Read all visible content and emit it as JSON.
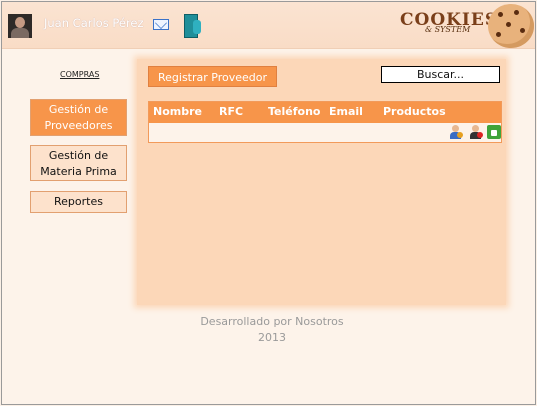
{
  "header": {
    "user_name": "Juan Carlos Pérez",
    "logo_text": "COOKIES",
    "logo_subtext": "& SYSTEM",
    "icons": [
      "user-avatar",
      "mail-icon",
      "exit-icon",
      "cookie-icon"
    ]
  },
  "nav": {
    "caption": "COMPRAS",
    "items": [
      {
        "label": "Gestión de Proveedores",
        "active": true
      },
      {
        "label": "Gestión de Materia Prima",
        "active": false
      },
      {
        "label": "Reportes",
        "active": false
      }
    ]
  },
  "main": {
    "register_label": "Registrar Proveedor",
    "search_value": "Buscar...",
    "table": {
      "columns": [
        "Nombre",
        "RFC",
        "Teléfono",
        "Email",
        "Productos"
      ],
      "action_icons": [
        "add-user-icon",
        "delete-user-icon",
        "unlock-icon"
      ]
    }
  },
  "footer": {
    "line1": "Desarrollado por Nosotros",
    "line2": "2013"
  },
  "colors": {
    "accent": "#f7954a",
    "panel": "#fcd7b8",
    "background": "#fdf3ea"
  }
}
